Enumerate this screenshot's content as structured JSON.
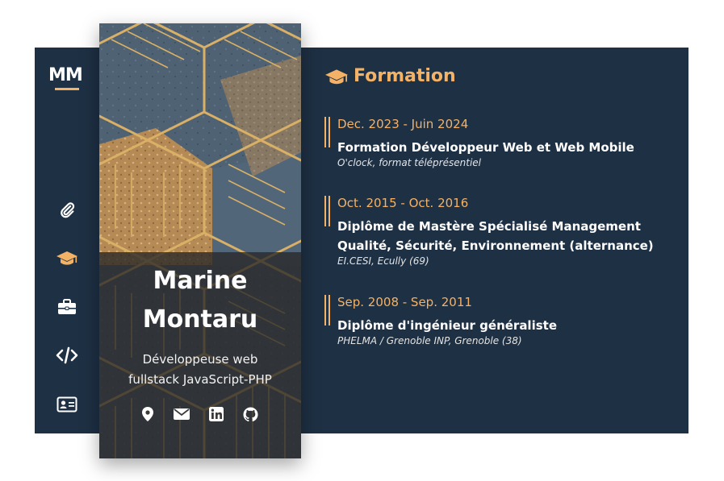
{
  "logo": "MM",
  "colors": {
    "background": "#1e3044",
    "accent": "#f4b266",
    "text": "#ffffff"
  },
  "sidebar": {
    "items": [
      {
        "icon": "paperclip-icon",
        "active": false
      },
      {
        "icon": "graduation-cap-icon",
        "active": true
      },
      {
        "icon": "briefcase-icon",
        "active": false
      },
      {
        "icon": "code-icon",
        "active": false
      },
      {
        "icon": "id-card-icon",
        "active": false
      }
    ]
  },
  "profile": {
    "first_name": "Marine",
    "last_name": "Montaru",
    "role_line1": "Développeuse web",
    "role_line2": "fullstack JavaScript-PHP",
    "social": [
      "location-pin-icon",
      "envelope-icon",
      "linkedin-icon",
      "github-icon"
    ]
  },
  "section": {
    "title": "Formation",
    "icon": "graduation-cap-icon",
    "entries": [
      {
        "date": "Dec. 2023 - Juin 2024",
        "title_line1": "Formation Développeur Web et Web Mobile",
        "title_line2": "",
        "place": "O'clock, format téléprésentiel"
      },
      {
        "date": "Oct. 2015 - Oct. 2016",
        "title_line1": "Diplôme de Mastère Spécialisé Management",
        "title_line2": "Qualité, Sécurité, Environnement (alternance)",
        "place": "EI.CESI, Ecully (69)"
      },
      {
        "date": "Sep. 2008 - Sep. 2011",
        "title_line1": "Diplôme d'ingénieur généraliste",
        "title_line2": "",
        "place": "PHELMA / Grenoble INP, Grenoble (38)"
      }
    ]
  }
}
